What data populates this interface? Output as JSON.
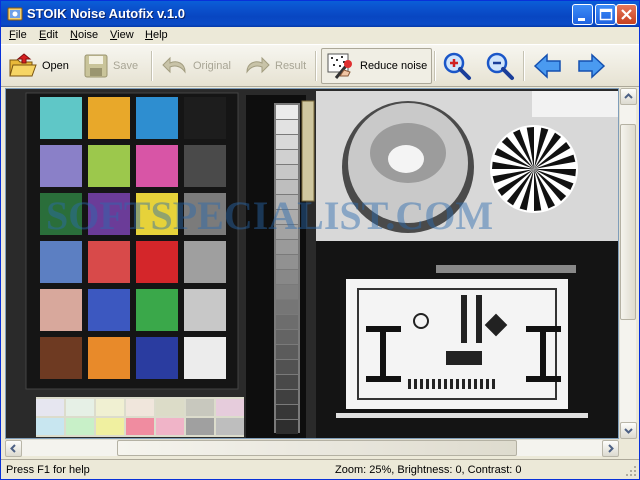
{
  "window": {
    "title": "STOIK Noise Autofix v.1.0",
    "controls": {
      "minimize": "minimize-icon",
      "maximize": "maximize-icon",
      "close": "close-icon"
    }
  },
  "menu": {
    "items": [
      {
        "first": "F",
        "rest": "ile"
      },
      {
        "first": "E",
        "rest": "dit"
      },
      {
        "first": "N",
        "rest": "oise"
      },
      {
        "first": "V",
        "rest": "iew"
      },
      {
        "first": "H",
        "rest": "elp"
      }
    ]
  },
  "toolbar": {
    "open": {
      "label": "Open",
      "icon": "folder-open-icon"
    },
    "save": {
      "label": "Save",
      "icon": "floppy-disk-icon",
      "enabled": false
    },
    "original": {
      "label": "Original",
      "icon": "undo-arrow-icon",
      "enabled": false
    },
    "result": {
      "label": "Result",
      "icon": "redo-arrow-icon",
      "enabled": false
    },
    "reduce_noise": {
      "label": "Reduce noise",
      "icon": "magic-wand-icon",
      "pressed": true
    },
    "zoom_in": {
      "icon": "zoom-in-icon"
    },
    "zoom_out": {
      "icon": "zoom-out-icon"
    },
    "back": {
      "icon": "arrow-left-icon"
    },
    "forward": {
      "icon": "arrow-right-icon"
    }
  },
  "image": {
    "watermark": "SOFTSPECIALIST.COM",
    "swatches": [
      "#5fc7c7",
      "#e8a82a",
      "#2e8ed0",
      "#1d1d1d",
      "#8a80c8",
      "#9cc84c",
      "#d855a6",
      "#4a4a4a",
      "#2a6e3a",
      "#6b3c98",
      "#e6d23a",
      "#7b7b7b",
      "#5c7fc2",
      "#d84a4a",
      "#d4262a",
      "#9f9f9f",
      "#d8a89c",
      "#3c58c0",
      "#3aa84a",
      "#c8c8c8",
      "#6e3a22",
      "#e88a2a",
      "#2a3ca0",
      "#ececec"
    ],
    "pastels": [
      "#e6e6f0",
      "#e6f0e6",
      "#f0f0d2",
      "#f0e6dc",
      "#dcdcc8",
      "#c8c8be",
      "#e6ccdc",
      "#c8e6f0",
      "#c8f0c8",
      "#f0f0a0",
      "#f08ca0",
      "#f0b4c8",
      "#a0a0a0",
      "#bebebe"
    ]
  },
  "status": {
    "help": "Press F1 for help",
    "info": "Zoom: 25%, Brightness: 0, Contrast: 0"
  }
}
